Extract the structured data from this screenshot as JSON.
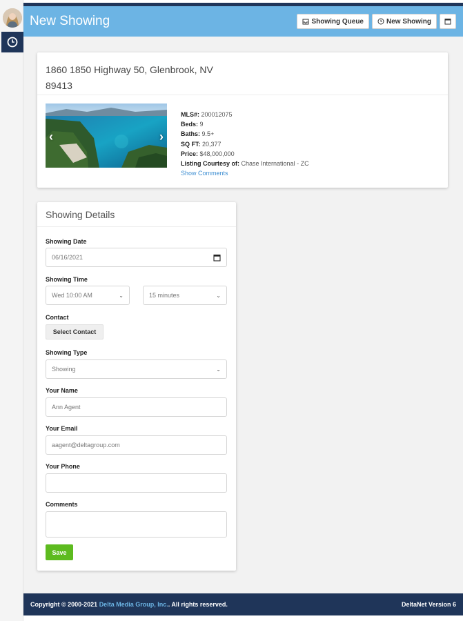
{
  "header": {
    "title": "New Showing",
    "queue_button": "Showing Queue",
    "new_button": "New Showing"
  },
  "listing": {
    "address_line1": "1860 1850 Highway 50, Glenbrook, NV",
    "address_line2": "89413",
    "mls_label": "MLS#:",
    "mls": "200012075",
    "beds_label": "Beds:",
    "beds": "9",
    "baths_label": "Baths:",
    "baths": "9.5+",
    "sqft_label": "SQ FT:",
    "sqft": "20,377",
    "price_label": "Price:",
    "price": "$48,000,000",
    "courtesy_label": "Listing Courtesy of:",
    "courtesy": "Chase International - ZC",
    "show_comments": "Show Comments"
  },
  "details": {
    "title": "Showing Details",
    "date_label": "Showing Date",
    "date_value": "06/16/2021",
    "time_label": "Showing Time",
    "time_value": "Wed 10:00 AM",
    "duration_value": "15 minutes",
    "contact_label": "Contact",
    "select_contact": "Select Contact",
    "type_label": "Showing Type",
    "type_value": "Showing",
    "name_label": "Your Name",
    "name_value": "Ann Agent",
    "email_label": "Your Email",
    "email_value": "aagent@deltagroup.com",
    "phone_label": "Your Phone",
    "phone_value": "",
    "comments_label": "Comments",
    "comments_value": "",
    "save": "Save"
  },
  "footer": {
    "copyright_prefix": "Copyright © 2000-2021",
    "company": "Delta Media Group, Inc.",
    "copyright_suffix": ". All rights reserved.",
    "version": "DeltaNet Version 6"
  },
  "colors": {
    "navy": "#1f3559",
    "header_blue": "#6cb4e4",
    "save_green": "#5dbb1f",
    "link_blue": "#3f8fd2"
  },
  "icons": [
    "clock-icon",
    "inbox-icon",
    "calendar-icon",
    "chevron-left-icon",
    "chevron-right-icon",
    "chevron-down-icon",
    "avatar"
  ]
}
